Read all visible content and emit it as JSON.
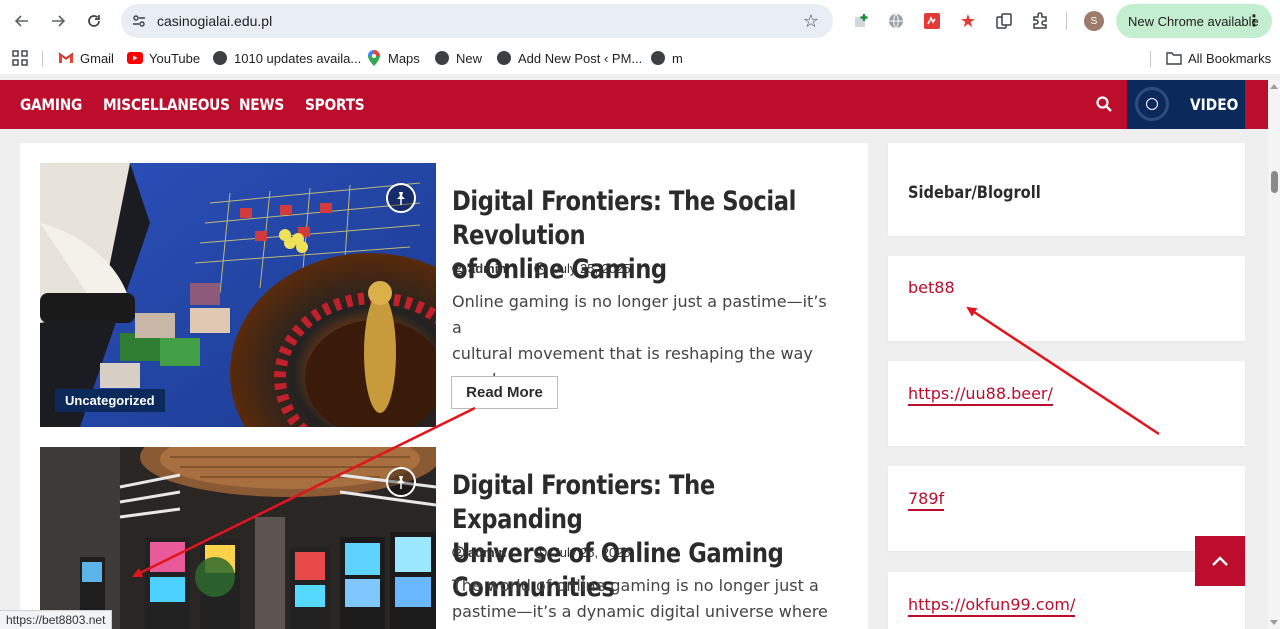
{
  "browser": {
    "url": "casinogialai.edu.pl",
    "profile_initial": "S",
    "update_label": "New Chrome available",
    "status_url": "https://bet8803.net"
  },
  "bookmarks": {
    "items": [
      {
        "label": "Gmail",
        "icon": "gmail-icon"
      },
      {
        "label": "YouTube",
        "icon": "youtube-icon"
      },
      {
        "label": "1010 updates availa...",
        "icon": "globe-icon"
      },
      {
        "label": "Maps",
        "icon": "maps-icon"
      },
      {
        "label": "New",
        "icon": "globe-icon"
      },
      {
        "label": "Add New Post ‹ PM...",
        "icon": "globe-icon"
      },
      {
        "label": "m",
        "icon": "globe-icon"
      }
    ],
    "all_bookmarks": "All Bookmarks"
  },
  "site_nav": {
    "items": [
      "GAMING",
      "MISCELLANEOUS",
      "NEWS",
      "SPORTS"
    ],
    "video_label": "VIDEO"
  },
  "posts": [
    {
      "title_line1": "Digital Frontiers: The Social Revolution",
      "title_line2": "of Online Gaming",
      "author": "admin",
      "date": "July 25, 2025",
      "excerpt_line1": "Online gaming is no longer just a pastime—it’s a",
      "excerpt_line2": "cultural movement that is reshaping the way",
      "excerpt_line3": "people…",
      "category": "Uncategorized",
      "read_more": "Read More"
    },
    {
      "title_line1": "Digital Frontiers: The Expanding",
      "title_line2": "Universe of Online Gaming Communities",
      "author": "admin",
      "date": "July 25, 2025",
      "excerpt_line1": "The world of online gaming is no longer just a",
      "excerpt_line2": "pastime—it’s a dynamic digital universe where"
    }
  ],
  "sidebar": {
    "title": "Sidebar/Blogroll",
    "links": [
      "bet88",
      "https://uu88.beer/",
      "789f",
      "https://okfun99.com/"
    ]
  },
  "colors": {
    "brand_red": "#bc0d2c",
    "navy": "#0b2a5b",
    "annotation_arrow": "#e3151c"
  }
}
